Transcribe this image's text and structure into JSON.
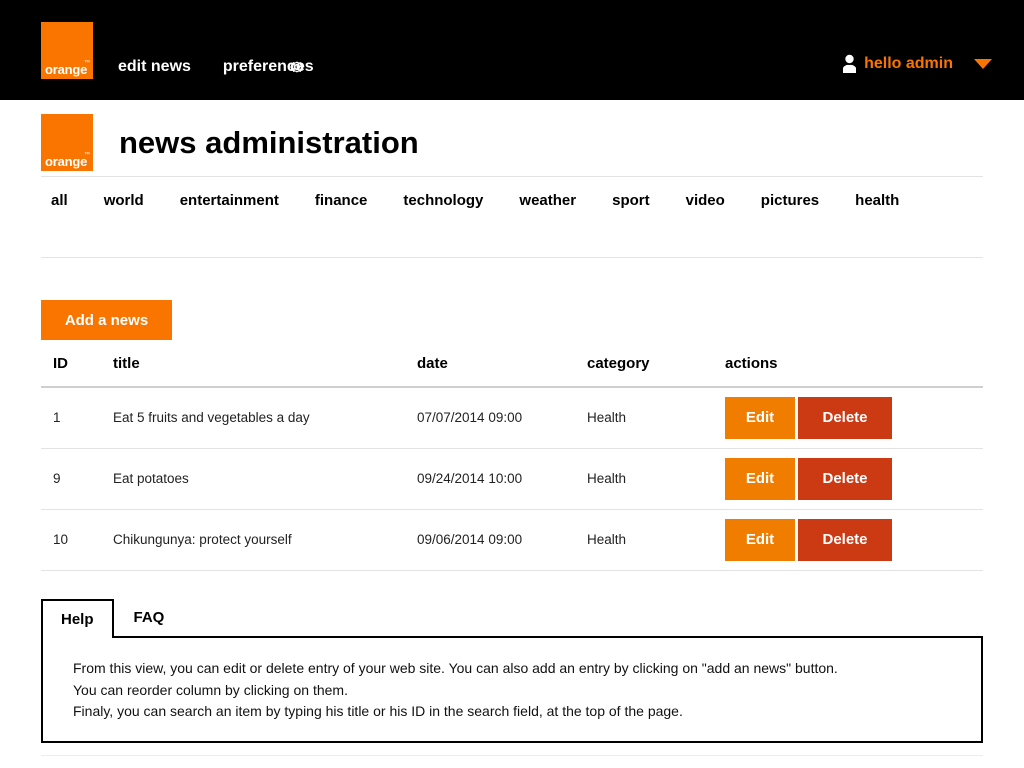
{
  "topbar": {
    "logo_word": "orange",
    "logo_tm": "™",
    "nav": [
      {
        "label": "edit news",
        "name": "edit-news"
      },
      {
        "label": "preferences",
        "name": "preferences"
      }
    ],
    "gear_icon": "gear-icon",
    "user_icon": "user-icon",
    "user_greeting": "hello admin",
    "caret_icon": "chevron-down-icon"
  },
  "header": {
    "logo_word": "orange",
    "logo_tm": "™",
    "title": "news administration"
  },
  "categories": [
    "all",
    "world",
    "entertainment",
    "finance",
    "technology",
    "weather",
    "sport",
    "video",
    "pictures",
    "health"
  ],
  "toolbar": {
    "add_label": "Add a news"
  },
  "table": {
    "columns": [
      "ID",
      "title",
      "date",
      "category",
      "actions"
    ],
    "rows": [
      {
        "id": "1",
        "title": "Eat 5 fruits and vegetables a day",
        "date": "07/07/2014 09:00",
        "category": "Health",
        "edit_label": "Edit",
        "delete_label": "Delete"
      },
      {
        "id": "9",
        "title": "Eat potatoes",
        "date": "09/24/2014 10:00",
        "category": "Health",
        "edit_label": "Edit",
        "delete_label": "Delete"
      },
      {
        "id": "10",
        "title": "Chikungunya: protect yourself",
        "date": "09/06/2014 09:00",
        "category": "Health",
        "edit_label": "Edit",
        "delete_label": "Delete"
      }
    ]
  },
  "help": {
    "tabs": [
      {
        "label": "Help",
        "active": true
      },
      {
        "label": "FAQ",
        "active": false
      }
    ],
    "lines": [
      "From this view, you can edit or delete entry of your web site. You can also add an entry by clicking on \"add an news\" button.",
      "You can reorder column by clicking on them.",
      "Finaly, you can search an item by typing his title or his ID in the search field, at the top of the page."
    ]
  },
  "colors": {
    "brand_orange": "#f97500",
    "edit_orange": "#f07d00",
    "delete_red": "#cc3a14",
    "header_black": "#000000"
  }
}
